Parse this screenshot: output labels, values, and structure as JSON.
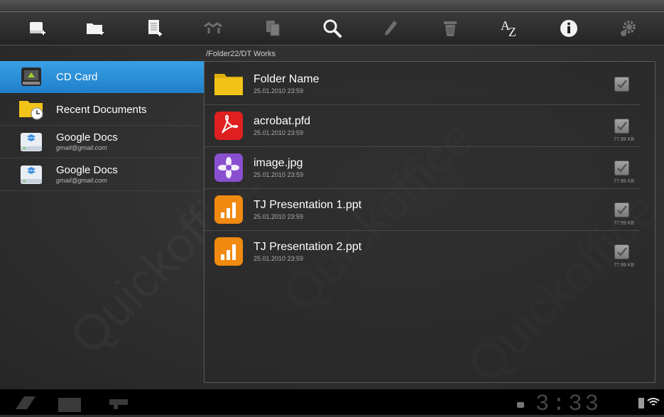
{
  "toolbar": {
    "buttons": [
      {
        "icon": "new-storage-icon"
      },
      {
        "icon": "new-folder-icon"
      },
      {
        "icon": "new-document-icon"
      },
      {
        "icon": "move-icon"
      },
      {
        "icon": "copy-icon"
      },
      {
        "icon": "search-icon"
      },
      {
        "icon": "rename-pencil-icon"
      },
      {
        "icon": "trash-icon"
      },
      {
        "icon": "sort-az-icon"
      },
      {
        "icon": "info-icon"
      },
      {
        "icon": "settings-gear-icon"
      }
    ]
  },
  "breadcrumb": "/Folder22/DT Works",
  "sidebar": {
    "items": [
      {
        "label": "CD Card",
        "active": true
      },
      {
        "label": "Recent Documents"
      },
      {
        "label": "Google Docs",
        "sub": "gmail@gmail.com"
      },
      {
        "label": "Google Docs",
        "sub": "gmail@gmail.com"
      }
    ]
  },
  "files": [
    {
      "name": "Folder Name",
      "date": "25.01.2010 23:59",
      "size": "",
      "type": "folder"
    },
    {
      "name": "acrobat.pfd",
      "date": "25.01.2010 23:59",
      "size": "77.99 KB",
      "type": "pdf"
    },
    {
      "name": "image.jpg",
      "date": "25.01.2010 23:59",
      "size": "77.99 KB",
      "type": "image"
    },
    {
      "name": "TJ Presentation 1.ppt",
      "date": "25.01.2010 23:59",
      "size": "77.99 KB",
      "type": "presentation"
    },
    {
      "name": "TJ Presentation 2.ppt",
      "date": "25.01.2010 23:59",
      "size": "77.99 KB",
      "type": "presentation"
    }
  ],
  "watermark": "Quickoffice",
  "statusbar": {
    "clock": "3:33"
  },
  "colors": {
    "accent": "#2a8fd8",
    "pdf": "#e02020",
    "image": "#8a4fd0",
    "presentation": "#f08a10",
    "folder": "#f2c418"
  }
}
